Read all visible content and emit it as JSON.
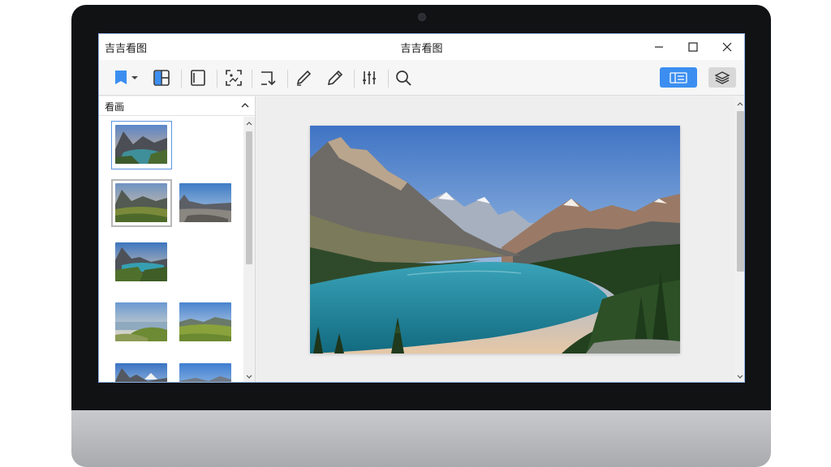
{
  "window": {
    "app_name": "吉吉看图",
    "title": "吉吉看图"
  },
  "toolbar": {
    "items": [
      "bookmark-icon",
      "grid-layout-icon",
      "panel-icon",
      "crop-icon",
      "rotate-icon",
      "pen-icon",
      "pencil-icon",
      "adjust-icon",
      "zoom-icon"
    ],
    "accent_color": "#3b8ef0"
  },
  "panel": {
    "title": "看画"
  },
  "thumbnails": [
    {
      "scene": "mountain-lake-dusk"
    },
    {
      "scene": "mountain-meadow"
    },
    {
      "scene": "valley-rocks"
    },
    {
      "scene": "mountain-lake-hill"
    },
    {
      "scene": "sea-horizon-grass"
    },
    {
      "scene": "meadow-hills"
    },
    {
      "scene": "mountain-peak"
    },
    {
      "scene": "mountain-ridge"
    }
  ],
  "viewer": {
    "image_subject": "mountain-lake-landscape"
  }
}
